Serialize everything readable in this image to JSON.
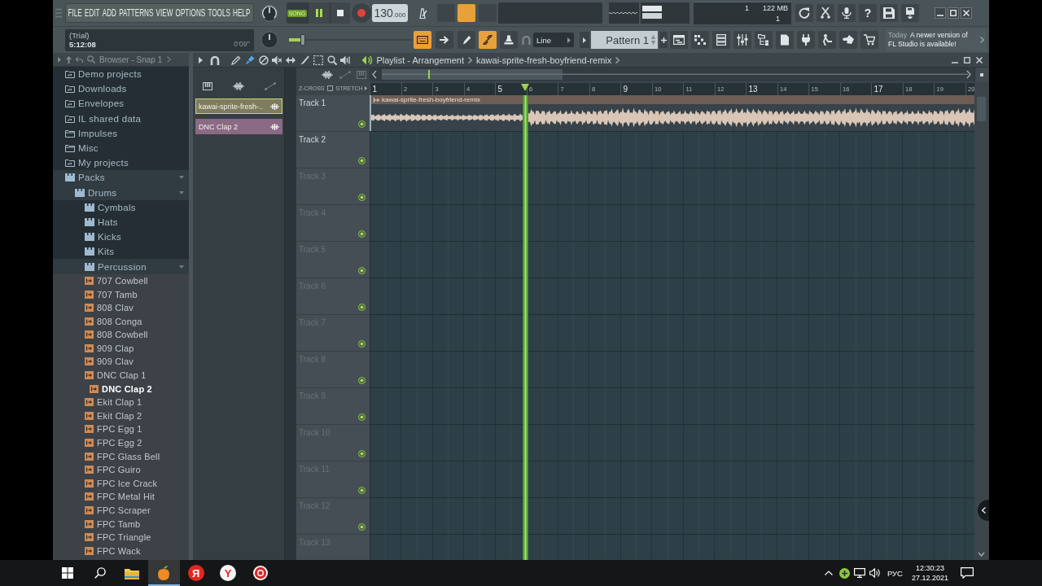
{
  "menu": {
    "items": [
      "FILE",
      "EDIT",
      "ADD",
      "PATTERNS",
      "VIEW",
      "OPTIONS",
      "TOOLS",
      "HELP"
    ]
  },
  "transport": {
    "mode": "SONG",
    "song_mode": true,
    "playing": true,
    "recording": false,
    "tempo": "130",
    "tempo_decimals": ".000"
  },
  "top_toggles": [
    {
      "on": false
    },
    {
      "on": true
    },
    {
      "on": false
    }
  ],
  "performance": {
    "value_1": "1",
    "memory": "122 MB",
    "value_2": "1"
  },
  "help_button": {
    "label": "?"
  },
  "hint_panel": {
    "title": "(Trial)",
    "text": "5:12:08",
    "time": "0'09\""
  },
  "pitch_slider": {
    "level": 0.1
  },
  "mode_toggles": [
    {
      "on": true
    },
    {
      "on": false
    },
    {
      "on": false
    },
    {
      "on": true
    },
    {
      "on": false
    }
  ],
  "snap": {
    "value": "Line"
  },
  "pattern": {
    "value": "Pattern 1"
  },
  "news": {
    "date": "Today",
    "message": "A newer version of FL Studio is available!"
  },
  "browser": {
    "title": "Browser - Snap 1",
    "items": [
      {
        "label": "Demo projects",
        "kind": "shortcut",
        "expanded": false,
        "selected": false
      },
      {
        "label": "Downloads",
        "kind": "shortcut",
        "expanded": false,
        "selected": false
      },
      {
        "label": "Envelopes",
        "kind": "shortcut",
        "expanded": false,
        "selected": false
      },
      {
        "label": "IL shared data",
        "kind": "shortcut",
        "expanded": false,
        "selected": false
      },
      {
        "label": "Impulses",
        "kind": "folder",
        "expanded": false,
        "selected": false
      },
      {
        "label": "Misc",
        "kind": "folder",
        "expanded": false,
        "selected": false
      },
      {
        "label": "My projects",
        "kind": "shortcut",
        "expanded": false,
        "selected": false
      },
      {
        "label": "Packs",
        "kind": "pack",
        "expanded": true,
        "selected": false,
        "children": [
          {
            "label": "Drums",
            "kind": "pack",
            "expanded": true,
            "selected": false,
            "children": [
              {
                "label": "Cymbals",
                "kind": "pack",
                "expanded": false,
                "selected": false
              },
              {
                "label": "Hats",
                "kind": "pack",
                "expanded": false,
                "selected": false
              },
              {
                "label": "Kicks",
                "kind": "pack",
                "expanded": false,
                "selected": false
              },
              {
                "label": "Kits",
                "kind": "pack",
                "expanded": false,
                "selected": false
              },
              {
                "label": "Percussion",
                "kind": "pack",
                "expanded": true,
                "selected": false,
                "children": [
                  {
                    "label": "707 Cowbell",
                    "kind": "sample",
                    "selected": false
                  },
                  {
                    "label": "707 Tamb",
                    "kind": "sample",
                    "selected": false
                  },
                  {
                    "label": "808 Clav",
                    "kind": "sample",
                    "selected": false
                  },
                  {
                    "label": "808 Conga",
                    "kind": "sample",
                    "selected": false
                  },
                  {
                    "label": "808 Cowbell",
                    "kind": "sample",
                    "selected": false
                  },
                  {
                    "label": "909 Clap",
                    "kind": "sample",
                    "selected": false
                  },
                  {
                    "label": "909 Clav",
                    "kind": "sample",
                    "selected": false
                  },
                  {
                    "label": "DNC Clap 1",
                    "kind": "sample",
                    "selected": false
                  },
                  {
                    "label": "DNC Clap 2",
                    "kind": "sample",
                    "selected": true
                  },
                  {
                    "label": "Ekit Clap 1",
                    "kind": "sample",
                    "selected": false
                  },
                  {
                    "label": "Ekit Clap 2",
                    "kind": "sample",
                    "selected": false
                  },
                  {
                    "label": "FPC Egg 1",
                    "kind": "sample",
                    "selected": false
                  },
                  {
                    "label": "FPC Egg 2",
                    "kind": "sample",
                    "selected": false
                  },
                  {
                    "label": "FPC Glass Bell",
                    "kind": "sample",
                    "selected": false
                  },
                  {
                    "label": "FPC Guiro",
                    "kind": "sample",
                    "selected": false
                  },
                  {
                    "label": "FPC Ice Crack",
                    "kind": "sample",
                    "selected": false
                  },
                  {
                    "label": "FPC Metal Hit",
                    "kind": "sample",
                    "selected": false
                  },
                  {
                    "label": "FPC Scraper",
                    "kind": "sample",
                    "selected": false
                  },
                  {
                    "label": "FPC Tamb",
                    "kind": "sample",
                    "selected": false
                  },
                  {
                    "label": "FPC Triangle",
                    "kind": "sample",
                    "selected": false
                  },
                  {
                    "label": "FPC Wack",
                    "kind": "sample",
                    "selected": false
                  }
                ]
              }
            ]
          }
        ]
      }
    ]
  },
  "picker": {
    "clips": [
      {
        "label": "kawai-sprite-fresh-..",
        "color": "#7e7c5e",
        "selected": true
      },
      {
        "label": "DNC Clap 2",
        "color": "#8a6a84",
        "selected": false
      }
    ]
  },
  "playlist": {
    "title": "Playlist - Arrangement",
    "breadcrumb": "kawai-sprite-fresh-boyfriend-remix",
    "tools": [
      {
        "selected": false
      },
      {
        "selected": true
      },
      {
        "selected": false
      },
      {
        "selected": false
      },
      {
        "selected": false
      },
      {
        "selected": false
      },
      {
        "selected": false
      },
      {
        "selected": false
      },
      {
        "selected": false
      }
    ],
    "z_cross": {
      "label": "Z-CROSS",
      "checked": false
    },
    "stretch": {
      "label": "STRETCH"
    },
    "bars": [
      "1",
      "2",
      "3",
      "4",
      "5",
      "6",
      "7",
      "8",
      "9",
      "10",
      "11",
      "12",
      "13",
      "14",
      "15",
      "16",
      "17",
      "18",
      "19",
      "20"
    ],
    "playhead": {
      "level": 0.2577
    },
    "tracks": [
      {
        "name": "Track 1",
        "dimmed": false,
        "muted": false,
        "clip": {
          "title": "kawai-sprite-fresh-boyfriend-remix"
        }
      },
      {
        "name": "Track 2",
        "dimmed": false,
        "muted": false
      },
      {
        "name": "Track 3",
        "dimmed": true,
        "muted": false
      },
      {
        "name": "Track 4",
        "dimmed": true,
        "muted": false
      },
      {
        "name": "Track 5",
        "dimmed": true,
        "muted": false
      },
      {
        "name": "Track 6",
        "dimmed": true,
        "muted": false
      },
      {
        "name": "Track 7",
        "dimmed": true,
        "muted": false
      },
      {
        "name": "Track 8",
        "dimmed": true,
        "muted": false
      },
      {
        "name": "Track 9",
        "dimmed": true,
        "muted": false
      },
      {
        "name": "Track 10",
        "dimmed": true,
        "muted": false
      },
      {
        "name": "Track 11",
        "dimmed": true,
        "muted": false
      },
      {
        "name": "Track 12",
        "dimmed": true,
        "muted": false
      },
      {
        "name": "Track 13",
        "dimmed": true
      }
    ]
  },
  "taskbar": {
    "apps": [
      {
        "active": false
      },
      {
        "active": true
      },
      {
        "active": false,
        "label": "Я"
      },
      {
        "active": false,
        "label": "Y"
      },
      {
        "active": false
      }
    ],
    "language": "РУС",
    "time": "12:30:23",
    "date": "27.12.2021"
  }
}
